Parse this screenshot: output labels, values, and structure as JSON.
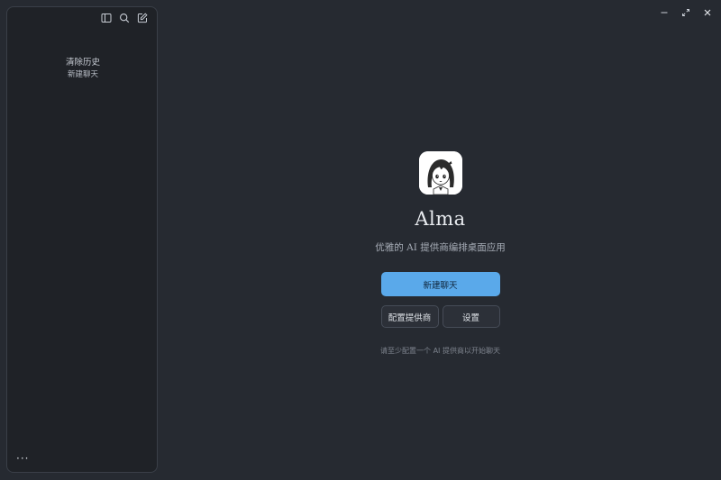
{
  "sidebar": {
    "toolbar": {
      "toggle_icon": "sidebar-toggle-icon",
      "search_icon": "search-icon",
      "compose_icon": "compose-icon"
    },
    "clear_history_label": "清除历史",
    "new_chat_label": "新建聊天",
    "more_label": "···"
  },
  "window": {
    "minimize_icon": "minimize-icon",
    "maximize_icon": "maximize-icon",
    "close_icon": "close-icon"
  },
  "main": {
    "app_name": "Alma",
    "tagline": "优雅的 AI 提供商编排桌面应用",
    "new_chat_button": "新建聊天",
    "configure_provider_button": "配置提供商",
    "settings_button": "设置",
    "hint": "请至少配置一个 AI 提供商以开始聊天"
  },
  "colors": {
    "background": "#262a31",
    "sidebar": "#1f2227",
    "accent": "#5aa9ea"
  }
}
